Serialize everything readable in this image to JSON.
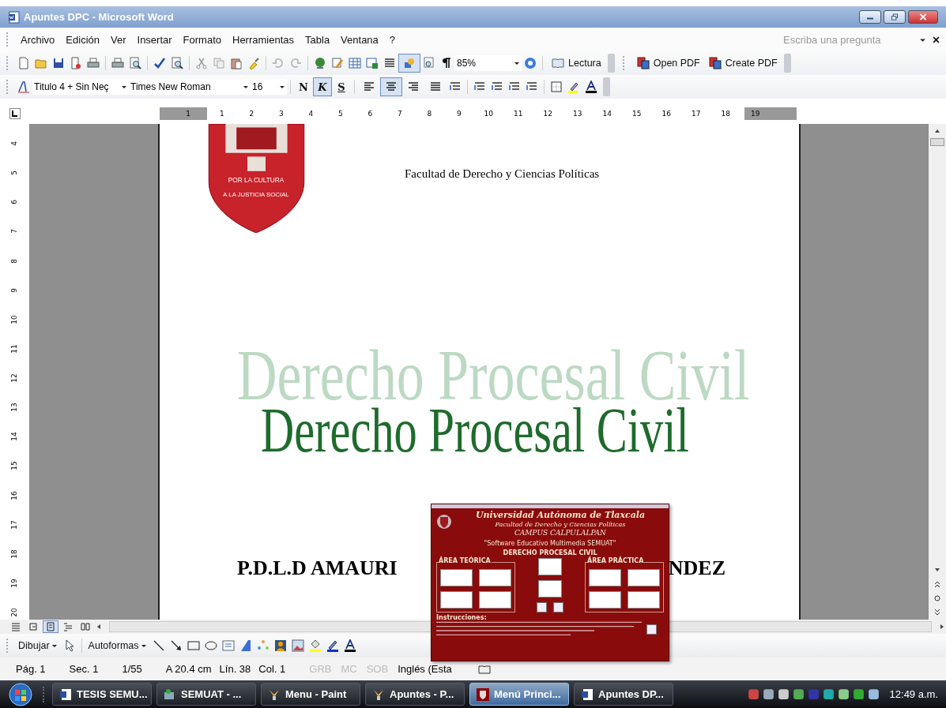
{
  "window": {
    "title": "Apuntes DPC - Microsoft Word"
  },
  "menu": {
    "items": [
      "Archivo",
      "Edición",
      "Ver",
      "Insertar",
      "Formato",
      "Herramientas",
      "Tabla",
      "Ventana",
      "?"
    ],
    "help_placeholder": "Escriba una pregunta"
  },
  "standard_toolbar": {
    "drawing_toggle_selected": true,
    "zoom": "85%",
    "reading_button": "Lectura",
    "pdf_buttons": [
      "Open PDF",
      "Create PDF"
    ]
  },
  "formatting_toolbar": {
    "style": "Titulo 4 + Sin Neç",
    "font": "Times New Roman",
    "size": "16",
    "styles": [
      {
        "label": "N",
        "selected": false
      },
      {
        "label": "K",
        "selected": true
      },
      {
        "label": "S",
        "selected": false
      }
    ],
    "alignments": [
      {
        "selected": false
      },
      {
        "selected": true
      },
      {
        "selected": false
      },
      {
        "selected": false
      }
    ]
  },
  "ruler": {
    "marks": [
      "1",
      "1",
      "2",
      "3",
      "4",
      "5",
      "6",
      "7",
      "8",
      "9",
      "10",
      "11",
      "12",
      "13",
      "14",
      "15",
      "16",
      "17",
      "18",
      "19"
    ]
  },
  "vertical_ruler": {
    "marks": [
      "4",
      "5",
      "6",
      "7",
      "8",
      "9",
      "10",
      "11",
      "12",
      "13",
      "14",
      "15",
      "16",
      "17",
      "18",
      "19",
      "20"
    ]
  },
  "document": {
    "logo_motto": [
      "POR LA CULTURA",
      "A LA JUSTICIA SOCIAL"
    ],
    "faculty": "Facultad de Derecho y Ciencias Políticas",
    "watermark": "Derecho Procesal Civil",
    "title": "Derecho Procesal Civil",
    "author_parts": [
      "P.D.L.D AMAURI",
      "NDEZ"
    ]
  },
  "view_buttons": [
    {
      "selected": false
    },
    {
      "selected": false
    },
    {
      "selected": true
    },
    {
      "selected": false
    },
    {
      "selected": false
    }
  ],
  "drawing_toolbar": {
    "draw_menu": "Dibujar",
    "autoshapes_menu": "Autoformas"
  },
  "status_bar": {
    "items": [
      {
        "text": "Pág. 1",
        "disabled": false
      },
      {
        "text": "Sec. 1",
        "disabled": false
      },
      {
        "text": "1/55",
        "disabled": false
      },
      {
        "text": "A 20.4 cm",
        "disabled": false
      },
      {
        "text": "Lín. 38",
        "disabled": false
      },
      {
        "text": "Col. 1",
        "disabled": false
      },
      {
        "text": "GRB",
        "disabled": true
      },
      {
        "text": "MC",
        "disabled": true
      },
      {
        "text": "SOB",
        "disabled": true
      },
      {
        "text": "Inglés (Esta",
        "disabled": false
      }
    ]
  },
  "popup": {
    "university": "Universidad Autónoma de Tlaxcala",
    "faculty": "Facultad de Derecho y Ciencias Políticas",
    "campus": "CAMPUS CALPULALPAN",
    "software": "\"Software Educativo Multimedia  SEMUAT\"",
    "subject": "DERECHO PROCESAL CIVIL",
    "theory_title": "ÁREA TEÓRICA",
    "practice_title": "ÁREA PRÁCTICA",
    "instructions_title": "Instrucciones:"
  },
  "taskbar": {
    "buttons": [
      {
        "label": "TESIS SEMU...",
        "kind": "word",
        "selected": false
      },
      {
        "label": "SEMUAT - ...",
        "kind": "app",
        "selected": false
      },
      {
        "label": "Menu - Paint",
        "kind": "paint",
        "selected": false
      },
      {
        "label": "Apuntes - P...",
        "kind": "paint",
        "selected": false
      },
      {
        "label": "Menú Princi...",
        "kind": "crest",
        "selected": true
      },
      {
        "label": "Apuntes DP...",
        "kind": "word",
        "selected": false
      }
    ],
    "clock": "12:49 a.m."
  }
}
